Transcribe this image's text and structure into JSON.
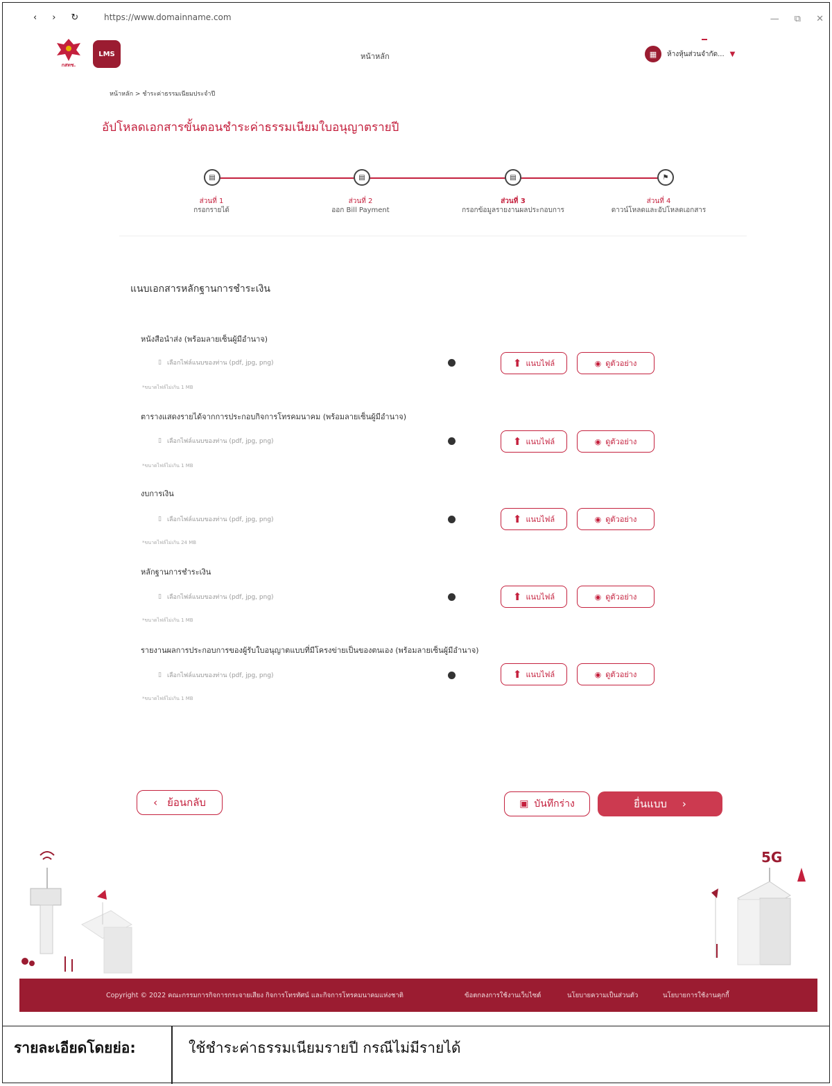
{
  "browser": {
    "back": "‹",
    "forward": "›",
    "reload": "↻",
    "url": "https://www.domainname.com",
    "minimize": "—",
    "restore": "⧉",
    "close": "✕"
  },
  "header": {
    "emblem_text": "กสทช.",
    "logo_text": "LMS",
    "home_label": "หน้าหลัก",
    "company_name": "ห้างหุ้นส่วนจำกัด..."
  },
  "breadcrumb": {
    "home": "หน้าหลัก",
    "separator": ">",
    "current": "ชำระค่าธรรมเนียมประจำปี"
  },
  "page_title": "อัปโหลดเอกสารขั้นตอนชำระค่าธรรมเนียมใบอนุญาตรายปี",
  "steps": [
    {
      "number": "ส่วนที่ 1",
      "name": "กรอกรายได้"
    },
    {
      "number": "ส่วนที่ 2",
      "name": "ออก Bill Payment"
    },
    {
      "number": "ส่วนที่ 3",
      "name": "กรอกข้อมูลรายงานผลประกอบการ"
    },
    {
      "number": "ส่วนที่ 4",
      "name": "ดาวน์โหลดและอัปโหลดเอกสาร"
    }
  ],
  "section_title": "แนบเอกสารหลักฐานการชำระเงิน",
  "documents": [
    {
      "label": "หนังสือนำส่ง (พร้อมลายเซ็นผู้มีอำนาจ)",
      "placeholder": "เลือกไฟล์แนบของท่าน (pdf, jpg, png)",
      "hint": "*ขนาดไฟล์ไม่เกิน 1 MB"
    },
    {
      "label": "ตารางแสดงรายได้จากการประกอบกิจการโทรคมนาคม (พร้อมลายเซ็นผู้มีอำนาจ)",
      "placeholder": "เลือกไฟล์แนบของท่าน (pdf, jpg, png)",
      "hint": "*ขนาดไฟล์ไม่เกิน 1 MB"
    },
    {
      "label": "งบการเงิน",
      "placeholder": "เลือกไฟล์แนบของท่าน (pdf, jpg, png)",
      "hint": "*ขนาดไฟล์ไม่เกิน 24 MB"
    },
    {
      "label": "หลักฐานการชำระเงิน",
      "placeholder": "เลือกไฟล์แนบของท่าน (pdf, jpg, png)",
      "hint": "*ขนาดไฟล์ไม่เกิน 1 MB"
    },
    {
      "label": "รายงานผลการประกอบการของผู้รับใบอนุญาตแบบที่มีโครงข่ายเป็นของตนเอง (พร้อมลายเซ็นผู้มีอำนาจ)",
      "placeholder": "เลือกไฟล์แนบของท่าน (pdf, jpg, png)",
      "hint": "*ขนาดไฟล์ไม่เกิน 1 MB"
    }
  ],
  "buttons": {
    "upload": "แนบไฟล์",
    "view_example": "ดูตัวอย่าง",
    "back": "ย้อนกลับ",
    "save_draft": "บันทึกร่าง",
    "submit": "ยื่นแบบ"
  },
  "illustration": {
    "badge": "5G"
  },
  "footer": {
    "copyright": "Copyright © 2022 คณะกรรมการกิจการกระจายเสียง กิจการโทรทัศน์ และกิจการโทรคมนาคมแห่งชาติ",
    "terms": "ข้อตกลงการใช้งานเว็บไซต์",
    "privacy": "นโยบายความเป็นส่วนตัว",
    "cookies": "นโยบายการใช้งานคุกกี้"
  },
  "summary": {
    "label": "รายละเอียดโดยย่อ:",
    "value": "ใช้ชำระค่าธรรมเนียมรายปี กรณีไม่มีรายได้"
  },
  "colors": {
    "accent": "#c4203d",
    "footer_bg": "#9b1c31",
    "submit_bg": "#cc3a50"
  }
}
